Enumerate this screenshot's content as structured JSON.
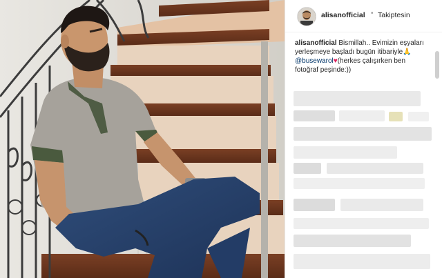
{
  "post": {
    "username": "alisanofficial",
    "separator": "•",
    "follow_label": "Takiptesin",
    "caption": {
      "username": "alisanofficial",
      "text_part1": "Bismillah.. Evimizin eşyaları yerleşmeye başladı bugün itibariyle",
      "emoji": "🙏",
      "mention": "@busewarol",
      "heart": "♥",
      "text_part2": "(herkes çalışırken ben fotoğraf peşinde:))"
    }
  },
  "colors": {
    "accent": "#3897f0",
    "mention": "#003569",
    "heart": "#e0245e"
  },
  "icons": {
    "verified": "verified-badge-icon"
  }
}
